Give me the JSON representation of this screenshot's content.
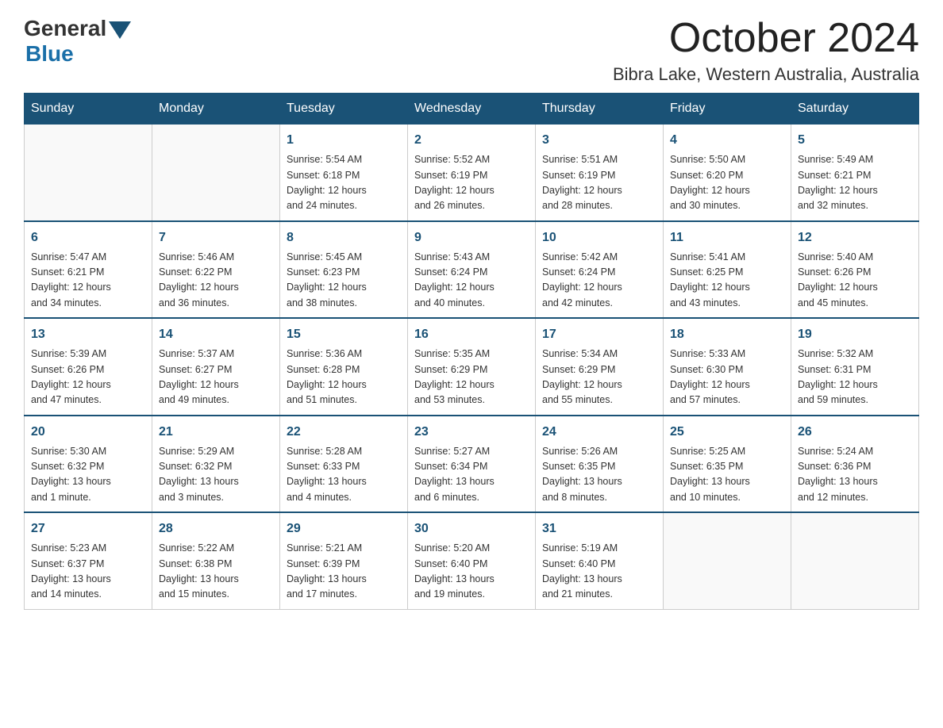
{
  "logo": {
    "general": "General",
    "blue": "Blue"
  },
  "title": "October 2024",
  "location": "Bibra Lake, Western Australia, Australia",
  "days_of_week": [
    "Sunday",
    "Monday",
    "Tuesday",
    "Wednesday",
    "Thursday",
    "Friday",
    "Saturday"
  ],
  "weeks": [
    [
      {
        "day": "",
        "info": ""
      },
      {
        "day": "",
        "info": ""
      },
      {
        "day": "1",
        "info": "Sunrise: 5:54 AM\nSunset: 6:18 PM\nDaylight: 12 hours\nand 24 minutes."
      },
      {
        "day": "2",
        "info": "Sunrise: 5:52 AM\nSunset: 6:19 PM\nDaylight: 12 hours\nand 26 minutes."
      },
      {
        "day": "3",
        "info": "Sunrise: 5:51 AM\nSunset: 6:19 PM\nDaylight: 12 hours\nand 28 minutes."
      },
      {
        "day": "4",
        "info": "Sunrise: 5:50 AM\nSunset: 6:20 PM\nDaylight: 12 hours\nand 30 minutes."
      },
      {
        "day": "5",
        "info": "Sunrise: 5:49 AM\nSunset: 6:21 PM\nDaylight: 12 hours\nand 32 minutes."
      }
    ],
    [
      {
        "day": "6",
        "info": "Sunrise: 5:47 AM\nSunset: 6:21 PM\nDaylight: 12 hours\nand 34 minutes."
      },
      {
        "day": "7",
        "info": "Sunrise: 5:46 AM\nSunset: 6:22 PM\nDaylight: 12 hours\nand 36 minutes."
      },
      {
        "day": "8",
        "info": "Sunrise: 5:45 AM\nSunset: 6:23 PM\nDaylight: 12 hours\nand 38 minutes."
      },
      {
        "day": "9",
        "info": "Sunrise: 5:43 AM\nSunset: 6:24 PM\nDaylight: 12 hours\nand 40 minutes."
      },
      {
        "day": "10",
        "info": "Sunrise: 5:42 AM\nSunset: 6:24 PM\nDaylight: 12 hours\nand 42 minutes."
      },
      {
        "day": "11",
        "info": "Sunrise: 5:41 AM\nSunset: 6:25 PM\nDaylight: 12 hours\nand 43 minutes."
      },
      {
        "day": "12",
        "info": "Sunrise: 5:40 AM\nSunset: 6:26 PM\nDaylight: 12 hours\nand 45 minutes."
      }
    ],
    [
      {
        "day": "13",
        "info": "Sunrise: 5:39 AM\nSunset: 6:26 PM\nDaylight: 12 hours\nand 47 minutes."
      },
      {
        "day": "14",
        "info": "Sunrise: 5:37 AM\nSunset: 6:27 PM\nDaylight: 12 hours\nand 49 minutes."
      },
      {
        "day": "15",
        "info": "Sunrise: 5:36 AM\nSunset: 6:28 PM\nDaylight: 12 hours\nand 51 minutes."
      },
      {
        "day": "16",
        "info": "Sunrise: 5:35 AM\nSunset: 6:29 PM\nDaylight: 12 hours\nand 53 minutes."
      },
      {
        "day": "17",
        "info": "Sunrise: 5:34 AM\nSunset: 6:29 PM\nDaylight: 12 hours\nand 55 minutes."
      },
      {
        "day": "18",
        "info": "Sunrise: 5:33 AM\nSunset: 6:30 PM\nDaylight: 12 hours\nand 57 minutes."
      },
      {
        "day": "19",
        "info": "Sunrise: 5:32 AM\nSunset: 6:31 PM\nDaylight: 12 hours\nand 59 minutes."
      }
    ],
    [
      {
        "day": "20",
        "info": "Sunrise: 5:30 AM\nSunset: 6:32 PM\nDaylight: 13 hours\nand 1 minute."
      },
      {
        "day": "21",
        "info": "Sunrise: 5:29 AM\nSunset: 6:32 PM\nDaylight: 13 hours\nand 3 minutes."
      },
      {
        "day": "22",
        "info": "Sunrise: 5:28 AM\nSunset: 6:33 PM\nDaylight: 13 hours\nand 4 minutes."
      },
      {
        "day": "23",
        "info": "Sunrise: 5:27 AM\nSunset: 6:34 PM\nDaylight: 13 hours\nand 6 minutes."
      },
      {
        "day": "24",
        "info": "Sunrise: 5:26 AM\nSunset: 6:35 PM\nDaylight: 13 hours\nand 8 minutes."
      },
      {
        "day": "25",
        "info": "Sunrise: 5:25 AM\nSunset: 6:35 PM\nDaylight: 13 hours\nand 10 minutes."
      },
      {
        "day": "26",
        "info": "Sunrise: 5:24 AM\nSunset: 6:36 PM\nDaylight: 13 hours\nand 12 minutes."
      }
    ],
    [
      {
        "day": "27",
        "info": "Sunrise: 5:23 AM\nSunset: 6:37 PM\nDaylight: 13 hours\nand 14 minutes."
      },
      {
        "day": "28",
        "info": "Sunrise: 5:22 AM\nSunset: 6:38 PM\nDaylight: 13 hours\nand 15 minutes."
      },
      {
        "day": "29",
        "info": "Sunrise: 5:21 AM\nSunset: 6:39 PM\nDaylight: 13 hours\nand 17 minutes."
      },
      {
        "day": "30",
        "info": "Sunrise: 5:20 AM\nSunset: 6:40 PM\nDaylight: 13 hours\nand 19 minutes."
      },
      {
        "day": "31",
        "info": "Sunrise: 5:19 AM\nSunset: 6:40 PM\nDaylight: 13 hours\nand 21 minutes."
      },
      {
        "day": "",
        "info": ""
      },
      {
        "day": "",
        "info": ""
      }
    ]
  ]
}
